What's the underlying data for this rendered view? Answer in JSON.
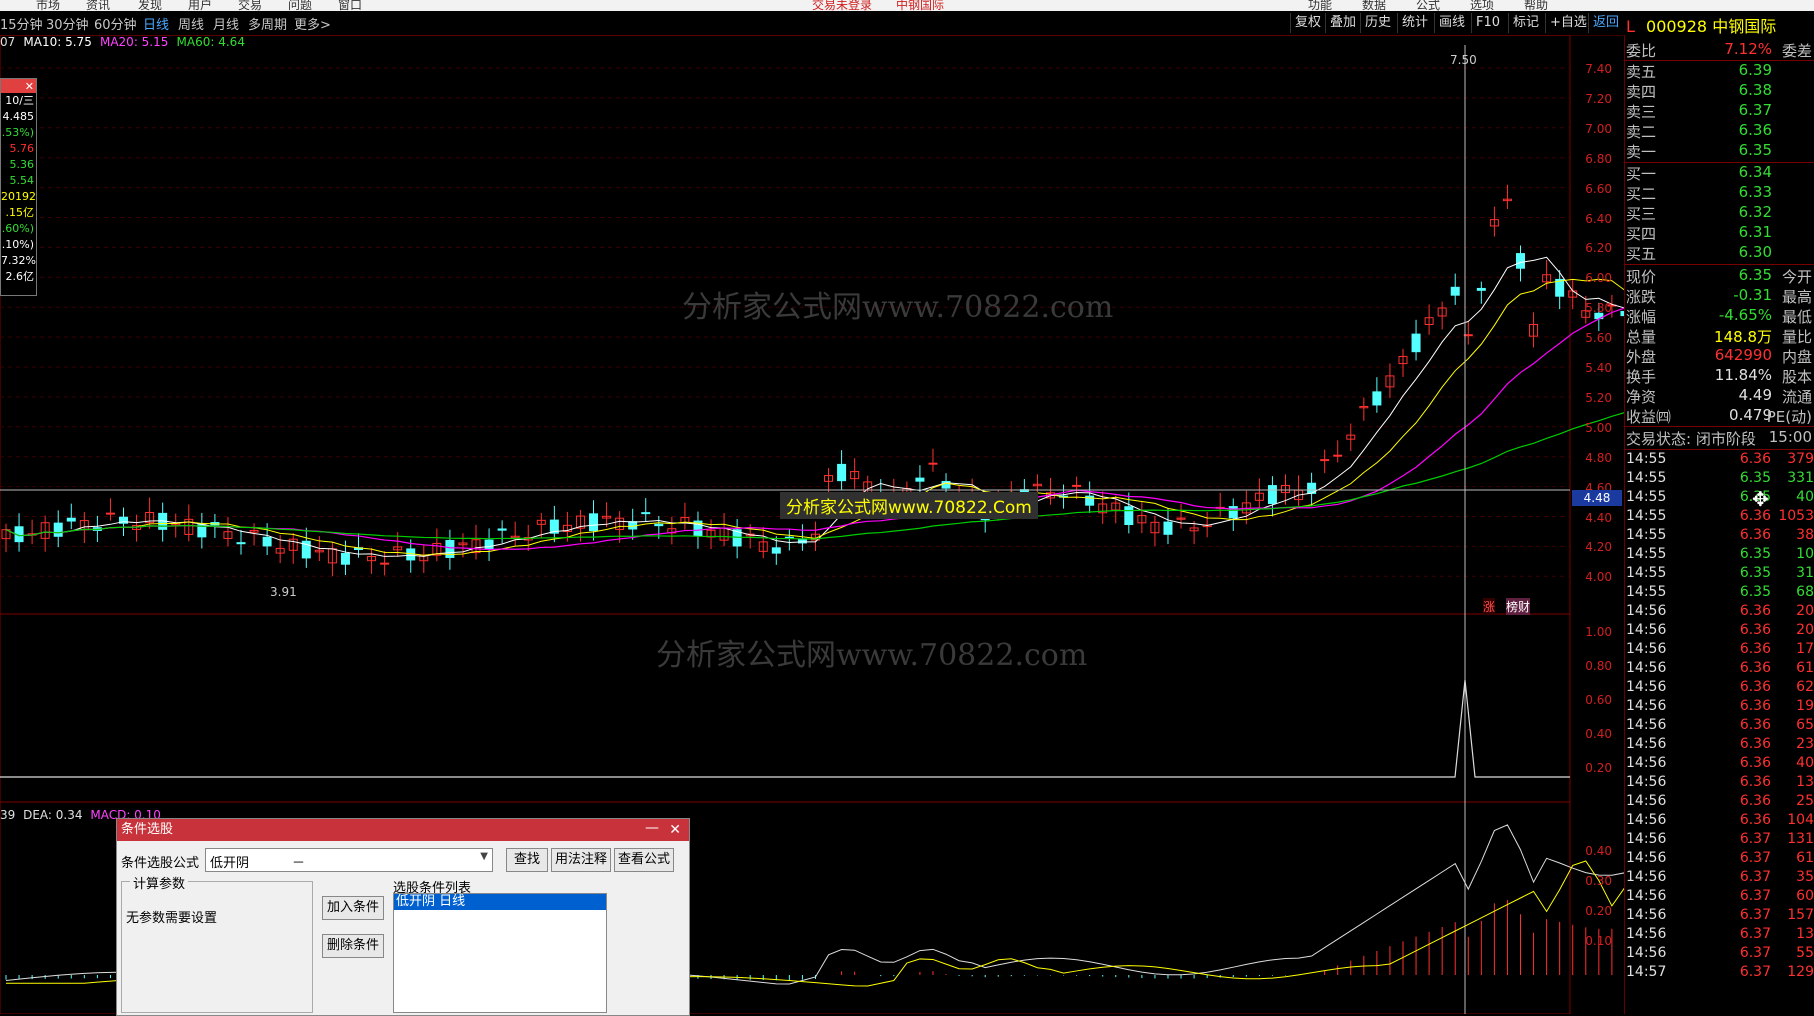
{
  "top_menu": [
    "市场",
    "资讯",
    "发现",
    "用户",
    "交易",
    "问题",
    "窗口",
    "交易未登录",
    "中钢国际",
    "功能",
    "数据",
    "公式",
    "选项",
    "帮助"
  ],
  "periods": [
    "15分钟",
    "30分钟",
    "60分钟",
    "日线",
    "周线",
    "月线",
    "多周期",
    "更多>"
  ],
  "active_period": "日线",
  "toolbar_right": [
    "复权",
    "叠加",
    "历史",
    "统计",
    "画线",
    "F10",
    "标记",
    "+自选",
    "返回"
  ],
  "stock": {
    "marker": "L",
    "code": "000928",
    "name": "中钢国际"
  },
  "ma_legend": {
    "prefix": "07",
    "ma10": "MA10: 5.75",
    "ma20": "MA20: 5.15",
    "ma60": "MA60: 4.64"
  },
  "macd_legend": {
    "prefix": "39",
    "dea": "DEA: 0.34",
    "macd": "MACD: 0.10"
  },
  "watermarks": [
    "分析家公式网www.70822.com",
    "分析家公式网www.70822.com"
  ],
  "chart_banner": "分析家公式网www.70822.Com",
  "cursor_price": "4.48",
  "high_label": "7.50",
  "low_label": "3.91",
  "badges": [
    "涨",
    "榜财"
  ],
  "info_box": [
    "10/三",
    "4.485",
    ".53%)",
    "5.76",
    "5.36",
    "5.54",
    "20192",
    ".15亿",
    ".60%)",
    ".10%)",
    "7.32%",
    "2.6亿"
  ],
  "main_axis": [
    "7.40",
    "7.20",
    "7.00",
    "6.80",
    "6.60",
    "6.40",
    "6.20",
    "6.00",
    "5.80",
    "5.60",
    "5.40",
    "5.20",
    "5.00",
    "4.80",
    "4.60",
    "4.40",
    "4.20",
    "4.00"
  ],
  "sub_axis": [
    "1.00",
    "0.80",
    "0.60",
    "0.40",
    "0.20"
  ],
  "macd_axis": [
    "0.40",
    "0.30",
    "0.20",
    "0.10"
  ],
  "quote": {
    "weibi_label": "委比",
    "weibi": "7.12%",
    "weicha_label": "委差",
    "asks": [
      {
        "label": "卖五",
        "price": "6.39"
      },
      {
        "label": "卖四",
        "price": "6.38"
      },
      {
        "label": "卖三",
        "price": "6.37"
      },
      {
        "label": "卖二",
        "price": "6.36"
      },
      {
        "label": "卖一",
        "price": "6.35"
      }
    ],
    "bids": [
      {
        "label": "买一",
        "price": "6.34"
      },
      {
        "label": "买二",
        "price": "6.33"
      },
      {
        "label": "买三",
        "price": "6.32"
      },
      {
        "label": "买四",
        "price": "6.31"
      },
      {
        "label": "买五",
        "price": "6.30"
      }
    ],
    "stats": [
      {
        "l": "现价",
        "v": "6.35",
        "r": "今开",
        "c": "green"
      },
      {
        "l": "涨跌",
        "v": "-0.31",
        "r": "最高",
        "c": "green"
      },
      {
        "l": "涨幅",
        "v": "-4.65%",
        "r": "最低",
        "c": "green"
      },
      {
        "l": "总量",
        "v": "148.8万",
        "r": "量比",
        "c": "yellow"
      },
      {
        "l": "外盘",
        "v": "642990",
        "r": "内盘",
        "c": "red"
      },
      {
        "l": "换手",
        "v": "11.84%",
        "r": "股本",
        "c": "white"
      },
      {
        "l": "净资",
        "v": "4.49",
        "r": "流通",
        "c": "white"
      },
      {
        "l": "收益㈣",
        "v": "0.479",
        "r": "PE(动)",
        "c": "white"
      }
    ],
    "trade_status": "交易状态: 闭市阶段",
    "trade_time": "15:00"
  },
  "ticks": [
    {
      "t": "14:55",
      "p": "6.36",
      "v": "379",
      "c": "red"
    },
    {
      "t": "14:55",
      "p": "6.35",
      "v": "331",
      "c": "green"
    },
    {
      "t": "14:55",
      "p": "6.35",
      "v": "40",
      "c": "green"
    },
    {
      "t": "14:55",
      "p": "6.36",
      "v": "1053",
      "c": "red"
    },
    {
      "t": "14:55",
      "p": "6.36",
      "v": "38",
      "c": "red"
    },
    {
      "t": "14:55",
      "p": "6.35",
      "v": "10",
      "c": "green"
    },
    {
      "t": "14:55",
      "p": "6.35",
      "v": "31",
      "c": "green"
    },
    {
      "t": "14:55",
      "p": "6.35",
      "v": "68",
      "c": "green"
    },
    {
      "t": "14:56",
      "p": "6.36",
      "v": "20",
      "c": "red"
    },
    {
      "t": "14:56",
      "p": "6.36",
      "v": "20",
      "c": "red"
    },
    {
      "t": "14:56",
      "p": "6.36",
      "v": "17",
      "c": "red"
    },
    {
      "t": "14:56",
      "p": "6.36",
      "v": "61",
      "c": "red"
    },
    {
      "t": "14:56",
      "p": "6.36",
      "v": "62",
      "c": "red"
    },
    {
      "t": "14:56",
      "p": "6.36",
      "v": "19",
      "c": "red"
    },
    {
      "t": "14:56",
      "p": "6.36",
      "v": "65",
      "c": "red"
    },
    {
      "t": "14:56",
      "p": "6.36",
      "v": "23",
      "c": "red"
    },
    {
      "t": "14:56",
      "p": "6.36",
      "v": "40",
      "c": "red"
    },
    {
      "t": "14:56",
      "p": "6.36",
      "v": "13",
      "c": "red"
    },
    {
      "t": "14:56",
      "p": "6.36",
      "v": "25",
      "c": "red"
    },
    {
      "t": "14:56",
      "p": "6.36",
      "v": "104",
      "c": "red"
    },
    {
      "t": "14:56",
      "p": "6.37",
      "v": "131",
      "c": "red"
    },
    {
      "t": "14:56",
      "p": "6.37",
      "v": "61",
      "c": "red"
    },
    {
      "t": "14:56",
      "p": "6.37",
      "v": "35",
      "c": "red"
    },
    {
      "t": "14:56",
      "p": "6.37",
      "v": "60",
      "c": "red"
    },
    {
      "t": "14:56",
      "p": "6.37",
      "v": "157",
      "c": "red"
    },
    {
      "t": "14:56",
      "p": "6.37",
      "v": "13",
      "c": "red"
    },
    {
      "t": "14:56",
      "p": "6.37",
      "v": "55",
      "c": "red"
    },
    {
      "t": "14:57",
      "p": "6.37",
      "v": "129",
      "c": "red"
    }
  ],
  "dialog": {
    "title": "条件选股",
    "formula_label": "条件选股公式",
    "formula_value": "低开阴",
    "formula_dash": "－",
    "btn_find": "查找",
    "btn_usage": "用法注释",
    "btn_view": "查看公式",
    "params_group": "计算参数",
    "params_text": "无参数需要设置",
    "btn_add": "加入条件",
    "btn_delete": "删除条件",
    "list_label": "选股条件列表",
    "list_item": "低开阴    日线"
  },
  "colors": {
    "ma10": "#ffffff",
    "ma20": "#ffff00",
    "ma60": "#ff00ff",
    "ma120": "#00cc00",
    "up": "#ff3030",
    "down": "#54ffff"
  }
}
